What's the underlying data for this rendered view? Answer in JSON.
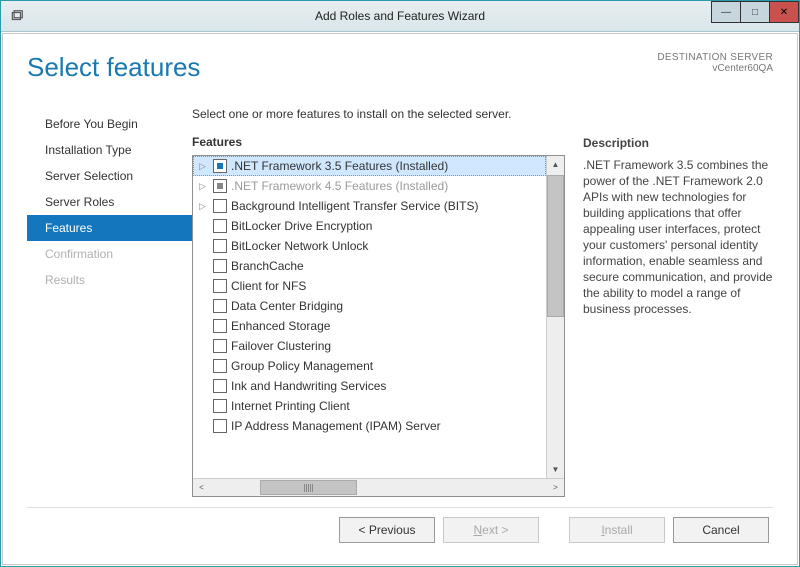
{
  "titlebar": {
    "title": "Add Roles and Features Wizard"
  },
  "header": {
    "title": "Select features"
  },
  "destination": {
    "label": "DESTINATION SERVER",
    "server": "vCenter60QA"
  },
  "nav": {
    "items": [
      {
        "label": "Before You Begin",
        "state": "normal"
      },
      {
        "label": "Installation Type",
        "state": "normal"
      },
      {
        "label": "Server Selection",
        "state": "normal"
      },
      {
        "label": "Server Roles",
        "state": "normal"
      },
      {
        "label": "Features",
        "state": "active"
      },
      {
        "label": "Confirmation",
        "state": "disabled"
      },
      {
        "label": "Results",
        "state": "disabled"
      }
    ]
  },
  "main": {
    "instruction": "Select one or more features to install on the selected server.",
    "features_label": "Features",
    "description_label": "Description",
    "description_text": ".NET Framework 3.5 combines the power of the .NET Framework 2.0 APIs with new technologies for building applications that offer appealing user interfaces, protect your customers' personal identity information, enable seamless and secure communication, and provide the ability to model a range of business processes.",
    "features": [
      {
        "label": ".NET Framework 3.5 Features (Installed)",
        "expandable": true,
        "check": "tri",
        "selected": true
      },
      {
        "label": ".NET Framework 4.5 Features (Installed)",
        "expandable": true,
        "check": "tri",
        "dim": true
      },
      {
        "label": "Background Intelligent Transfer Service (BITS)",
        "expandable": true,
        "check": "empty"
      },
      {
        "label": "BitLocker Drive Encryption",
        "expandable": false,
        "check": "empty"
      },
      {
        "label": "BitLocker Network Unlock",
        "expandable": false,
        "check": "empty"
      },
      {
        "label": "BranchCache",
        "expandable": false,
        "check": "empty"
      },
      {
        "label": "Client for NFS",
        "expandable": false,
        "check": "empty"
      },
      {
        "label": "Data Center Bridging",
        "expandable": false,
        "check": "empty"
      },
      {
        "label": "Enhanced Storage",
        "expandable": false,
        "check": "empty"
      },
      {
        "label": "Failover Clustering",
        "expandable": false,
        "check": "empty"
      },
      {
        "label": "Group Policy Management",
        "expandable": false,
        "check": "empty"
      },
      {
        "label": "Ink and Handwriting Services",
        "expandable": false,
        "check": "empty"
      },
      {
        "label": "Internet Printing Client",
        "expandable": false,
        "check": "empty"
      },
      {
        "label": "IP Address Management (IPAM) Server",
        "expandable": false,
        "check": "empty"
      }
    ]
  },
  "footer": {
    "previous": "< Previous",
    "next_prefix": "N",
    "next_rest": "ext >",
    "install_prefix": "I",
    "install_rest": "nstall",
    "cancel": "Cancel"
  }
}
